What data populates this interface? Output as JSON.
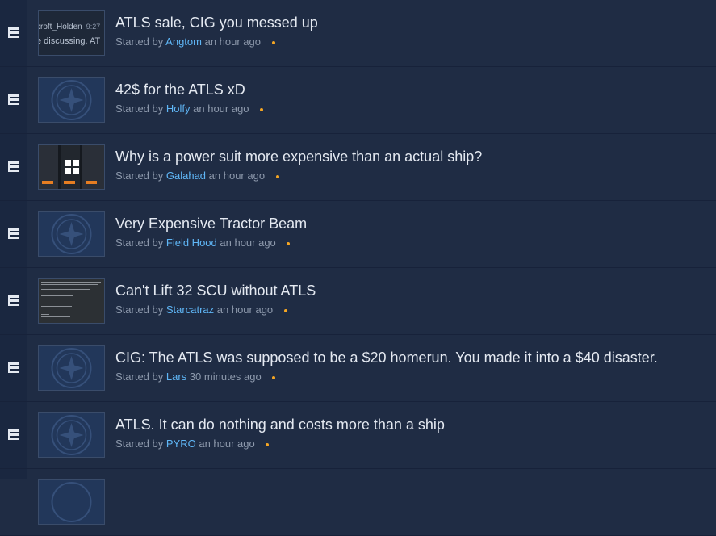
{
  "threads": [
    {
      "title": "ATLS sale, CIG you messed up",
      "started_by": "Started by",
      "author": "Angtom",
      "time": "an hour ago",
      "thumb": "chat-preview",
      "preview_user": "croft_Holden",
      "preview_time": "9:27",
      "preview_line": "e discussing. AT"
    },
    {
      "title": "42$ for the ATLS xD",
      "started_by": "Started by",
      "author": "Holfy",
      "time": "an hour ago",
      "thumb": "emblem"
    },
    {
      "title": "Why is a power suit more expensive than an actual ship?",
      "started_by": "Started by",
      "author": "Galahad",
      "time": "an hour ago",
      "thumb": "store-preview"
    },
    {
      "title": "Very Expensive Tractor Beam",
      "started_by": "Started by",
      "author": "Field Hood",
      "time": "an hour ago",
      "thumb": "emblem"
    },
    {
      "title": "Can't Lift 32 SCU without ATLS",
      "started_by": "Started by",
      "author": "Starcatraz",
      "time": "an hour ago",
      "thumb": "document-preview"
    },
    {
      "title": "CIG: The ATLS was supposed to be a $20 homerun. You made it into a $40 disaster.",
      "started_by": "Started by",
      "author": "Lars",
      "time": "30 minutes ago",
      "thumb": "emblem"
    },
    {
      "title": "ATLS. It can do nothing and costs more than a ship",
      "started_by": "Started by",
      "author": "PYRO",
      "time": "an hour ago",
      "thumb": "emblem"
    }
  ],
  "colors": {
    "accent": "#5fb6f6",
    "unread_dot": "#f5a623",
    "background": "#1f2c44"
  },
  "icons": {
    "row": "thread-list-icon",
    "thumb_overlay": "windows-logo-icon"
  }
}
